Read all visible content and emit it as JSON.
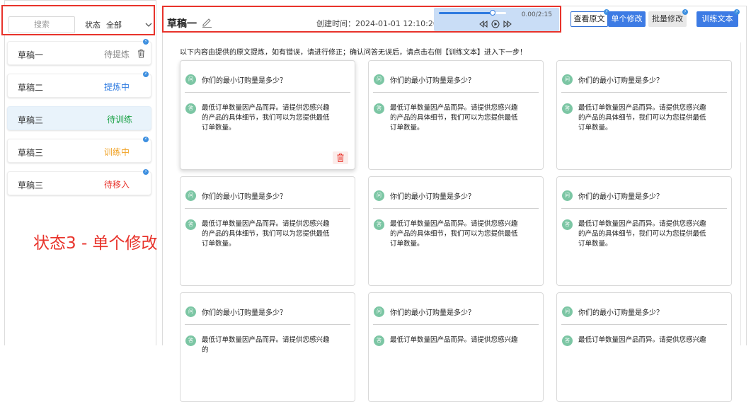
{
  "sidebar": {
    "search_placeholder": "搜索",
    "status_label": "状态",
    "status_value": "全部",
    "items": [
      {
        "name": "草稿一",
        "status": "待提炼",
        "status_color": "#888888",
        "show_trash": true
      },
      {
        "name": "草稿二",
        "status": "提炼中",
        "status_color": "#2f7be0",
        "show_trash": false
      },
      {
        "name": "草稿三",
        "status": "待训练",
        "status_color": "#1fa34a",
        "show_trash": false
      },
      {
        "name": "草稿三",
        "status": "训练中",
        "status_color": "#f0a020",
        "show_trash": false
      },
      {
        "name": "草稿三",
        "status": "待移入",
        "status_color": "#e8332b",
        "show_trash": false
      }
    ]
  },
  "annotation": {
    "label": "状态3 - 单个修改"
  },
  "header": {
    "title": "草稿一",
    "created": "创建时间：2024-01-01 12:10:20",
    "player": {
      "time": "0.00/2:15",
      "progress": 0.8
    }
  },
  "toolbar": {
    "view_original": "查看原文",
    "single_edit": "单个修改",
    "batch_edit": "批量修改",
    "train_text": "训练文本"
  },
  "hint": "以下内容由提供的原文提炼，如有错误，请进行修正；确认问答无误后，请点击右侧【训练文本】进入下一步！",
  "qa": {
    "q_badge": "问",
    "a_badge": "答",
    "cards": [
      {
        "q": "你们的最小订购量是多少？",
        "a": "最低订单数量因产品而异。请提供您感兴趣的产品的具体细节，我们可以为您提供最低订单数量。"
      },
      {
        "q": "你们的最小订购量是多少？",
        "a": "最低订单数量因产品而异。请提供您感兴趣的产品的具体细节，我们可以为您提供最低订单数量。"
      },
      {
        "q": "你们的最小订购量是多少？",
        "a": "最低订单数量因产品而异。请提供您感兴趣的产品的具体细节，我们可以为您提供最低订单数量。"
      },
      {
        "q": "你们的最小订购量是多少？",
        "a": "最低订单数量因产品而异。请提供您感兴趣的产品的具体细节，我们可以为您提供最低订单数量。"
      },
      {
        "q": "你们的最小订购量是多少？",
        "a": "最低订单数量因产品而异。请提供您感兴趣的产品的具体细节，我们可以为您提供最低订单数量。"
      },
      {
        "q": "你们的最小订购量是多少？",
        "a": "最低订单数量因产品而异。请提供您感兴趣的产品的具体细节，我们可以为您提供最低订单数量。"
      },
      {
        "q": "你们的最小订购量是多少？",
        "a": "最低订单数量因产品而异。请提供您感兴趣的"
      },
      {
        "q": "你们的最小订购量是多少？",
        "a": "最低订单数量因产品而异。请提供您感兴趣"
      },
      {
        "q": "你们的最小订购量是多少？",
        "a": "最低订单数量因产品而异。请提供您感兴趣"
      }
    ]
  },
  "colors": {
    "accent": "#3d7be4",
    "highlight": "#e8332b",
    "badge": "#7cc6a4"
  }
}
